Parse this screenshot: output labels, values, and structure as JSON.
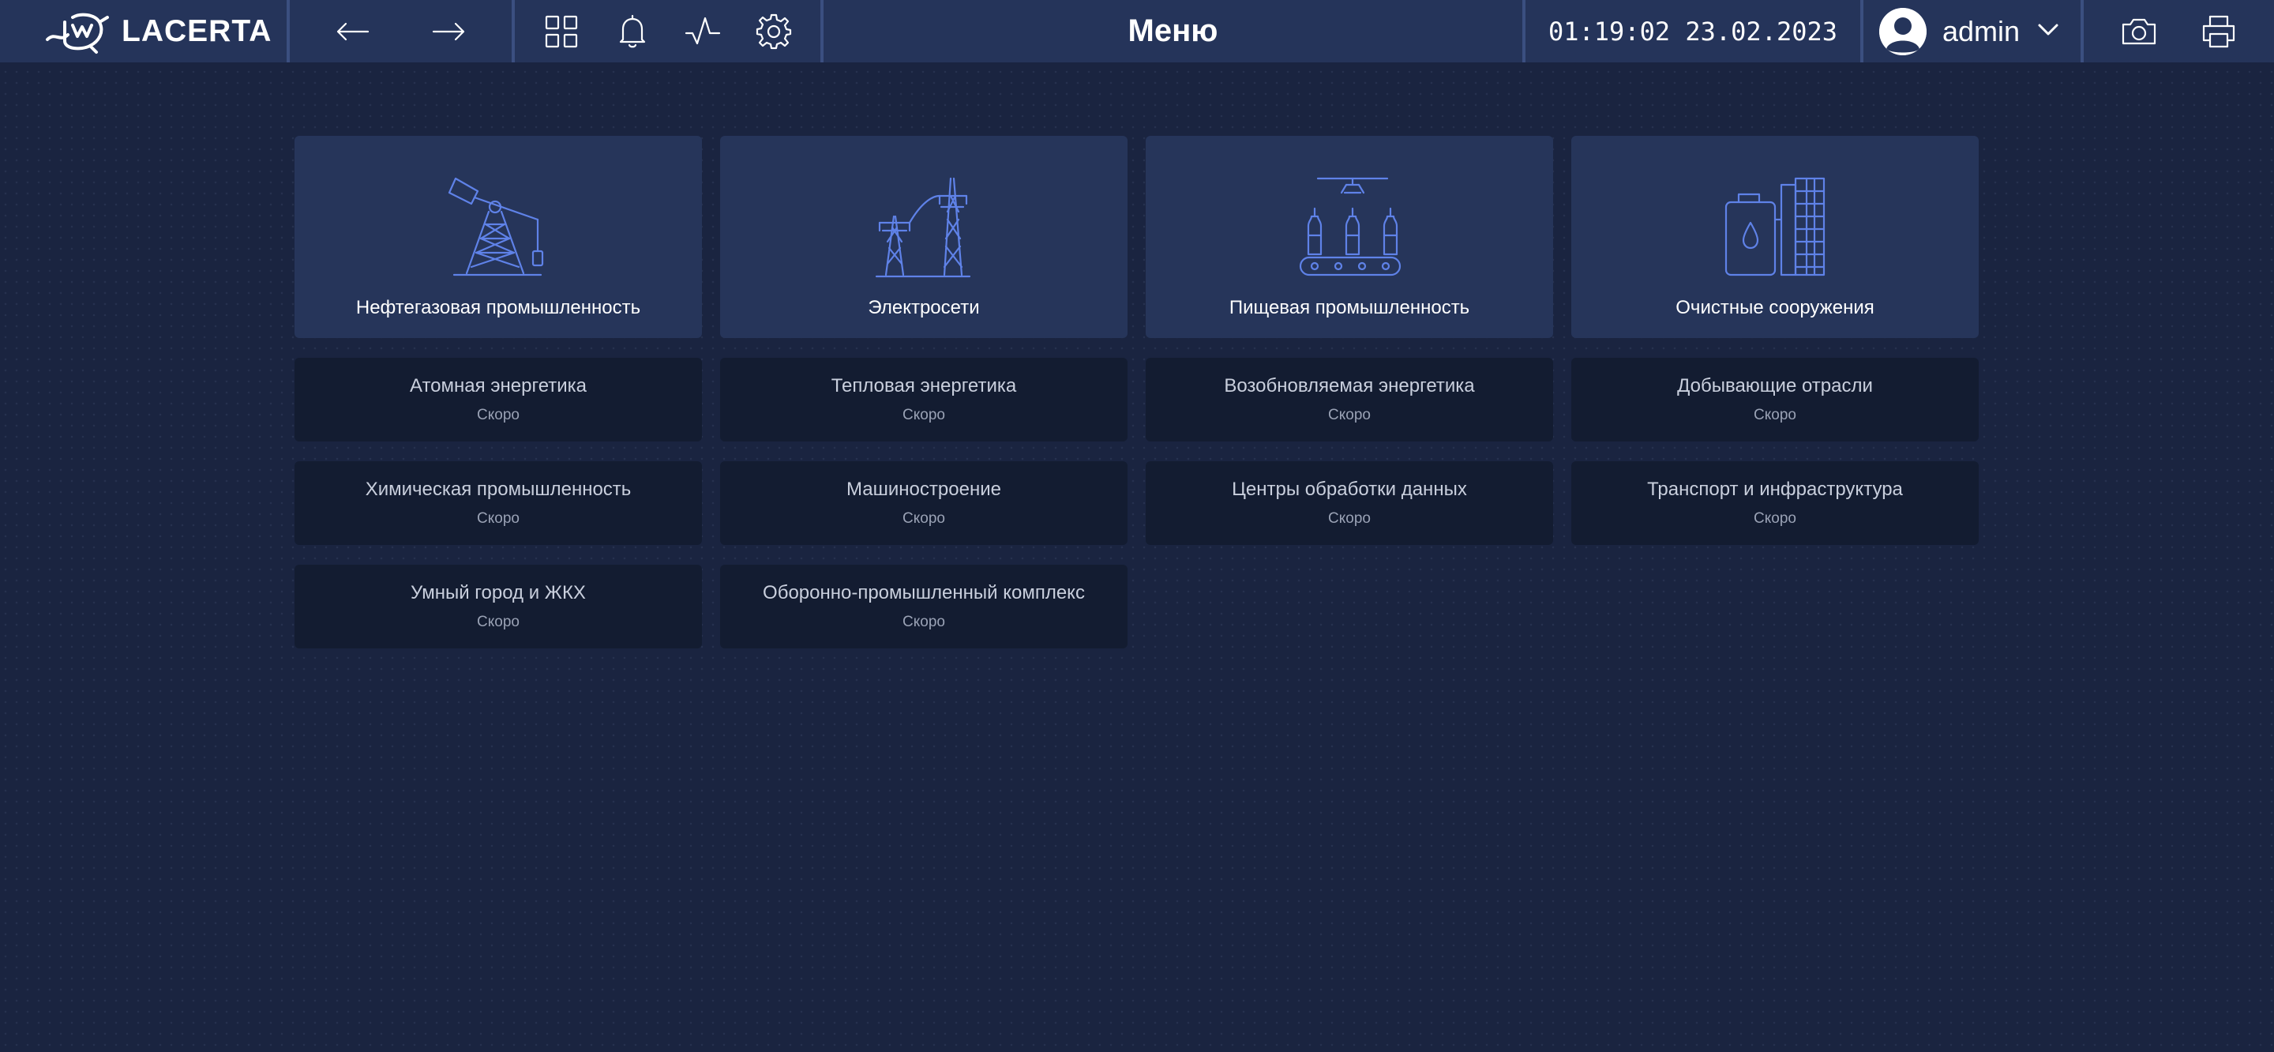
{
  "header": {
    "brand": "LACERTA",
    "title": "Меню",
    "datetime": "01:19:02 23.02.2023",
    "user": "admin"
  },
  "icons": {
    "back": "arrow-left-icon",
    "forward": "arrow-right-icon",
    "grid": "grid-icon",
    "notifications": "bell-icon",
    "activity": "pulse-icon",
    "settings": "gear-icon",
    "screenshot": "camera-icon",
    "print": "printer-icon"
  },
  "colors": {
    "topbar": "#25345a",
    "background": "#1a2440",
    "active_card": "#26355a",
    "inactive_card": "#131c31",
    "icon_accent": "#5f82e8"
  },
  "sections": [
    {
      "label": "Нефтегазовая промышленность",
      "icon": "oil-pump-icon"
    },
    {
      "label": "Электросети",
      "icon": "power-line-icon"
    },
    {
      "label": "Пищевая промышленность",
      "icon": "bottling-conveyor-icon"
    },
    {
      "label": "Очистные сооружения",
      "icon": "treatment-plant-icon"
    }
  ],
  "upcoming": [
    {
      "label": "Атомная энергетика",
      "status": "Скоро"
    },
    {
      "label": "Тепловая энергетика",
      "status": "Скоро"
    },
    {
      "label": "Возобновляемая энергетика",
      "status": "Скоро"
    },
    {
      "label": "Добывающие отрасли",
      "status": "Скоро"
    },
    {
      "label": "Химическая промышленность",
      "status": "Скоро"
    },
    {
      "label": "Машиностроение",
      "status": "Скоро"
    },
    {
      "label": "Центры обработки данных",
      "status": "Скоро"
    },
    {
      "label": "Транспорт и инфраструктура",
      "status": "Скоро"
    },
    {
      "label": "Умный город и ЖКХ",
      "status": "Скоро"
    },
    {
      "label": "Оборонно-промышленный комплекс",
      "status": "Скоро"
    }
  ]
}
